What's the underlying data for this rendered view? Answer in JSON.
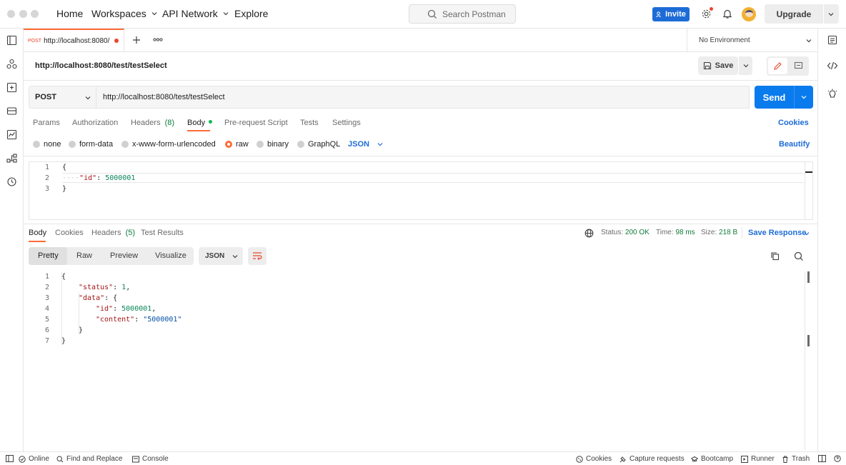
{
  "topbar": {
    "nav": [
      "Home",
      "Workspaces",
      "API Network",
      "Explore"
    ],
    "search_placeholder": "Search Postman",
    "invite_label": "Invite",
    "upgrade_label": "Upgrade"
  },
  "tab": {
    "method": "POST",
    "title": "http://localhost:8080/"
  },
  "environment": "No Environment",
  "request": {
    "title": "http://localhost:8080/test/testSelect",
    "save_label": "Save",
    "method": "POST",
    "url": "http://localhost:8080/test/testSelect",
    "send_label": "Send",
    "tabs": {
      "params": "Params",
      "authorization": "Authorization",
      "headers": "Headers",
      "headers_count": "(8)",
      "body": "Body",
      "prerequest": "Pre-request Script",
      "tests": "Tests",
      "settings": "Settings"
    },
    "cookies_link": "Cookies",
    "body_types": [
      "none",
      "form-data",
      "x-www-form-urlencoded",
      "raw",
      "binary",
      "GraphQL"
    ],
    "body_format": "JSON",
    "beautify_label": "Beautify",
    "body_lines": {
      "l1": "{",
      "l2_key": "\"id\"",
      "l2_val": "5000001",
      "l3": "}"
    }
  },
  "response": {
    "tabs": {
      "body": "Body",
      "cookies": "Cookies",
      "headers": "Headers",
      "headers_count": "(5)",
      "test_results": "Test Results"
    },
    "status_label": "Status:",
    "status_value": "200 OK",
    "time_label": "Time:",
    "time_value": "98 ms",
    "size_label": "Size:",
    "size_value": "218 B",
    "save_response": "Save Response",
    "views": [
      "Pretty",
      "Raw",
      "Preview",
      "Visualize"
    ],
    "format": "JSON",
    "lines": {
      "status_key": "\"status\"",
      "status_val": "1",
      "data_key": "\"data\"",
      "id_key": "\"id\"",
      "id_val": "5000001",
      "content_key": "\"content\"",
      "content_val": "\"5000001\""
    }
  },
  "statusbar": {
    "online": "Online",
    "find_replace": "Find and Replace",
    "console": "Console",
    "cookies": "Cookies",
    "capture": "Capture requests",
    "bootcamp": "Bootcamp",
    "runner": "Runner",
    "trash": "Trash"
  },
  "colors": {
    "accent_orange": "#ff6c37",
    "send_blue": "#097bed",
    "link_blue": "#1d6cd6",
    "status_green": "#0f7b3b"
  }
}
